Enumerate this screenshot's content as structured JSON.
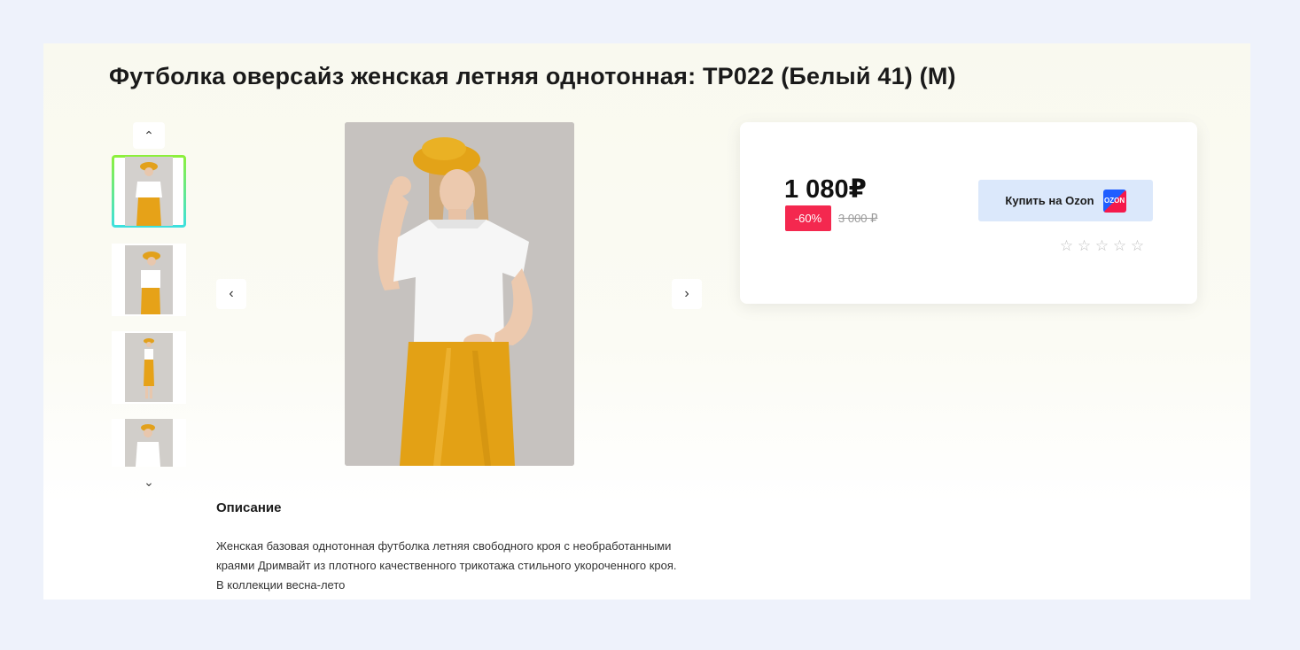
{
  "product": {
    "title": "Футболка оверсайз женская летняя однотонная: ТР022 (Белый 41) (М)"
  },
  "gallery": {
    "up_arrow": "⌃",
    "down_arrow": "⌄",
    "prev_arrow": "‹",
    "next_arrow": "›",
    "thumbnails": [
      {
        "name": "thumbnail-1",
        "active": true
      },
      {
        "name": "thumbnail-2",
        "active": false
      },
      {
        "name": "thumbnail-3",
        "active": false
      },
      {
        "name": "thumbnail-4",
        "active": false
      }
    ]
  },
  "purchase": {
    "price": "1 080₽",
    "discount": "-60%",
    "old_price": "3 000 ₽",
    "buy_label": "Купить на Ozon",
    "ozon_icon_text": "OZON",
    "rating_stars": [
      "☆",
      "☆",
      "☆",
      "☆",
      "☆"
    ]
  },
  "description": {
    "heading": "Описание",
    "text": "Женская базовая однотонная футболка летняя свободного кроя с необработанными краями Дримвайт из плотного качественного трикотажа стильного укороченного кроя. В коллекции весна-лето"
  },
  "colors": {
    "discount_badge": "#f4284f",
    "buy_button_bg": "#dbe8fb",
    "active_thumb_border_top": "#8ef03a",
    "active_thumb_border_bottom": "#3ce0e0"
  }
}
